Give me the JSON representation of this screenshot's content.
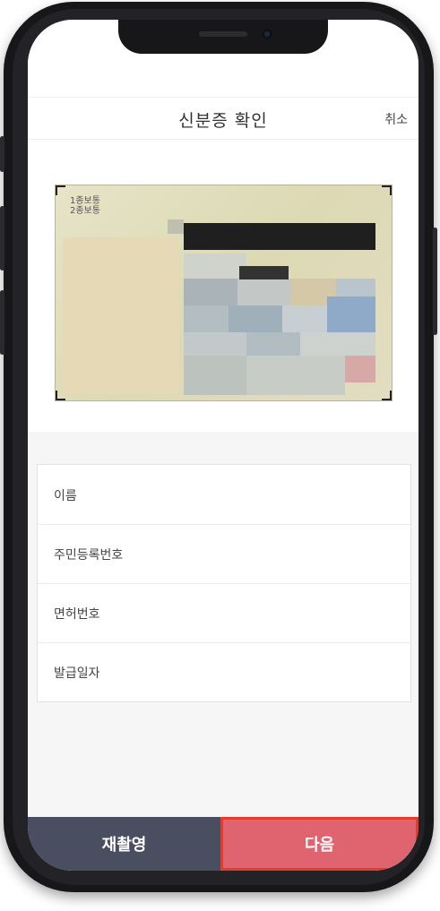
{
  "header": {
    "title": "신분증 확인",
    "cancel_label": "취소"
  },
  "id_card": {
    "label_line1": "1종보통",
    "label_line2": "2종보통"
  },
  "form": {
    "fields": [
      {
        "label": "이름"
      },
      {
        "label": "주민등록번호"
      },
      {
        "label": "면허번호"
      },
      {
        "label": "발급일자"
      }
    ]
  },
  "footer": {
    "retake_label": "재촬영",
    "next_label": "다음"
  },
  "colors": {
    "retake_button": "#4a4e61",
    "next_button": "#e0646f",
    "next_button_border": "#e53a2c",
    "background": "#f6f6f6"
  }
}
